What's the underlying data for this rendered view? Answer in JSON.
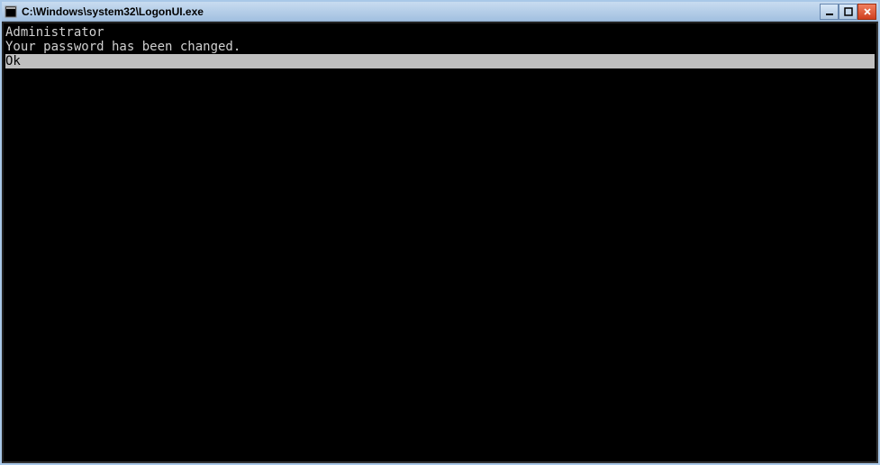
{
  "window": {
    "title": "C:\\Windows\\system32\\LogonUI.exe"
  },
  "console": {
    "lines": [
      {
        "text": "Administrator",
        "selected": false
      },
      {
        "text": "Your password has been changed.",
        "selected": false
      },
      {
        "text": "Ok",
        "selected": true
      }
    ]
  }
}
